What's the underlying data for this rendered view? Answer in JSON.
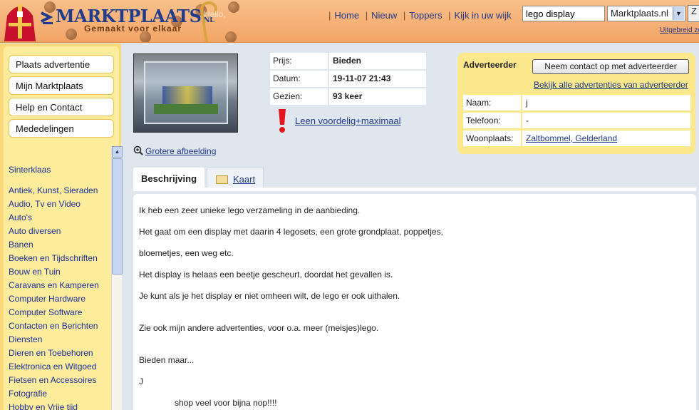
{
  "header": {
    "logo_text": "MARKTPLAATS",
    "logo_tld": ".NL",
    "tagline": "Gemaakt voor elkaar",
    "greeting": "Hallo,",
    "nav": [
      "Home",
      "Nieuw",
      "Toppers",
      "Kijk in uw wijk"
    ],
    "search_value": "lego display",
    "site_select": "Marktplaats.nl",
    "go_label": "Z",
    "extended_link": "Uitgebreid zoeken"
  },
  "sidebar": {
    "buttons": [
      "Plaats advertentie",
      "Mijn Marktplaats",
      "Help en Contact",
      "Mededelingen"
    ],
    "featured": "Sinterklaas",
    "categories": [
      "Antiek, Kunst, Sieraden",
      "Audio, Tv en Video",
      "Auto's",
      "Auto diversen",
      "Banen",
      "Boeken en Tijdschriften",
      "Bouw en Tuin",
      "Caravans en Kamperen",
      "Computer Hardware",
      "Computer Software",
      "Contacten en Berichten",
      "Diensten",
      "Dieren en Toebehoren",
      "Elektronica en Witgoed",
      "Fietsen en Accessoires",
      "Fotografie",
      "Hobby en Vrije tijd"
    ]
  },
  "listing": {
    "zoom_link": "Grotere afbeelding",
    "info": [
      {
        "label": "Prijs:",
        "value": "Bieden"
      },
      {
        "label": "Datum:",
        "value": "19-11-07 21:43"
      },
      {
        "label": "Gezien:",
        "value": "93 keer"
      }
    ],
    "promo_link": "Leen voordelig+maximaal"
  },
  "advertiser": {
    "title": "Adverteerder",
    "contact_button": "Neem contact op met adverteerder",
    "all_ads_link": "Bekijk alle advertenties van adverteerder",
    "rows": [
      {
        "label": "Naam:",
        "value": "j"
      },
      {
        "label": "Telefoon:",
        "value": "-"
      },
      {
        "label": "Woonplaats:",
        "value": "Zaltbommel, Gelderland"
      }
    ]
  },
  "tabs": {
    "description": "Beschrijving",
    "map": "Kaart"
  },
  "description_lines": [
    "Ik heb een zeer unieke lego verzameling in de aanbieding.",
    "Het gaat om een display met daarin 4 legosets, een grote grondplaat, poppetjes,",
    "bloemetjes, een weg etc.",
    "Het display is helaas een beetje gescheurt, doordat het gevallen is.",
    "Je kunt als je het display er niet omheen wilt, de lego er ook uithalen.",
    "Zie ook mijn andere advertenties, voor o.a. meer (meisjes)lego.",
    "Bieden maar...",
    "J",
    "shop veel voor bijna nop!!!!"
  ]
}
